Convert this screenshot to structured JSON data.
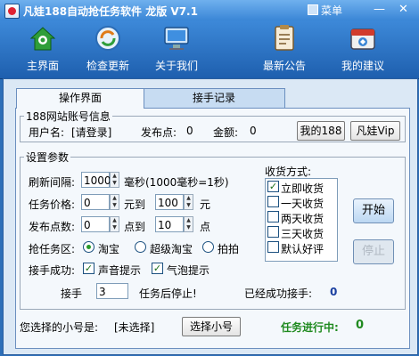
{
  "app": {
    "title": "凡娃188自动抢任务软件  龙版 V7.1",
    "menu_label": "菜单",
    "minimize": "—",
    "close": "✕"
  },
  "toolbar": [
    {
      "label": "主界面",
      "icon": "home-icon"
    },
    {
      "label": "检查更新",
      "icon": "update-icon"
    },
    {
      "label": "关于我们",
      "icon": "monitor-icon"
    },
    {
      "label": "最新公告",
      "icon": "notice-icon"
    },
    {
      "label": "我的建议",
      "icon": "suggestion-icon"
    }
  ],
  "tabs": {
    "active": "操作界面",
    "inactive": "接手记录"
  },
  "account": {
    "legend": "188网站账号信息",
    "username_label": "用户名:",
    "username_value": "[请登录]",
    "points_label": "发布点:",
    "points_value": "0",
    "amount_label": "金额:",
    "amount_value": "0",
    "my188_button": "我的188",
    "vip_button": "凡娃Vip"
  },
  "settings": {
    "legend": "设置参数",
    "interval_label": "刷新间隔:",
    "interval_value": "1000",
    "interval_unit": "毫秒(1000毫秒=1秒)",
    "price_label": "任务价格:",
    "price_from": "0",
    "price_to_label": "元到",
    "price_to": "100",
    "price_unit": "元",
    "points_label": "发布点数:",
    "points_from": "0",
    "points_to_label": "点到",
    "points_to": "10",
    "points_unit": "点",
    "zone_label": "抢任务区:",
    "zones": [
      "淘宝",
      "超级淘宝",
      "拍拍"
    ],
    "zone_selected": 0,
    "success_label": "接手成功:",
    "sound_label": "声音提示",
    "bubble_label": "气泡提示",
    "stop_label_pre": "接手",
    "stop_value": "3",
    "stop_label_post": "任务后停止!",
    "success_count_label": "已经成功接手:",
    "success_count": "0"
  },
  "receipt": {
    "title": "收货方式:",
    "options": [
      {
        "label": "立即收货",
        "checked": true
      },
      {
        "label": "一天收货",
        "checked": false
      },
      {
        "label": "两天收货",
        "checked": false
      },
      {
        "label": "三天收货",
        "checked": false
      },
      {
        "label": "默认好评",
        "checked": false
      }
    ]
  },
  "actions": {
    "start": "开始",
    "stop": "停止"
  },
  "footer": {
    "account_label": "您选择的小号是:",
    "account_value": "[未选择]",
    "select_button": "选择小号",
    "status_label": "任务进行中:",
    "status_value": "0"
  },
  "colors": {
    "title_bar": "#3a86d6",
    "toolbar": "#1e5fae",
    "panel": "#dbe8f5",
    "status_green": "#1f8a1f",
    "count_blue": "#1a3fa0"
  }
}
